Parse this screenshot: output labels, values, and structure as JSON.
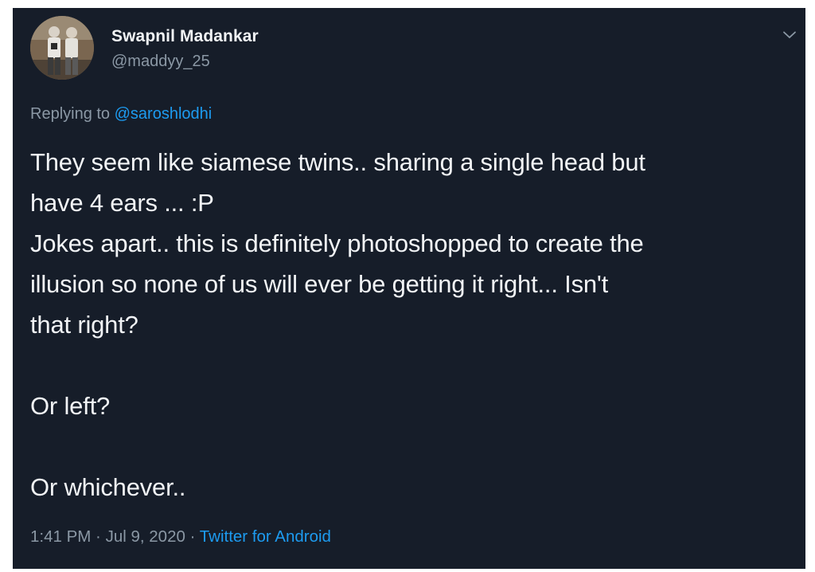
{
  "tweet": {
    "author_name": "Swapnil Madankar",
    "author_handle": "@maddyy_25",
    "replying_prefix": "Replying to ",
    "replying_to": "@saroshlodhi",
    "lines": [
      "They seem like siamese twins.. sharing a single head but",
      "have 4 ears ... :P",
      "Jokes apart.. this is definitely photoshopped to create the",
      "illusion so none of us will ever be getting it right... Isn't",
      "that right?"
    ],
    "line_or_left": "Or left?",
    "line_whichever": "Or whichever..",
    "time": "1:41 PM",
    "separator": " · ",
    "date": "Jul 9, 2020",
    "source": "Twitter for Android"
  },
  "colors": {
    "background": "#161d29",
    "text": "#f2f4f6",
    "secondary": "#8b98a5",
    "link": "#1d9bf0"
  },
  "icons": {
    "more": "chevron-down-icon"
  }
}
